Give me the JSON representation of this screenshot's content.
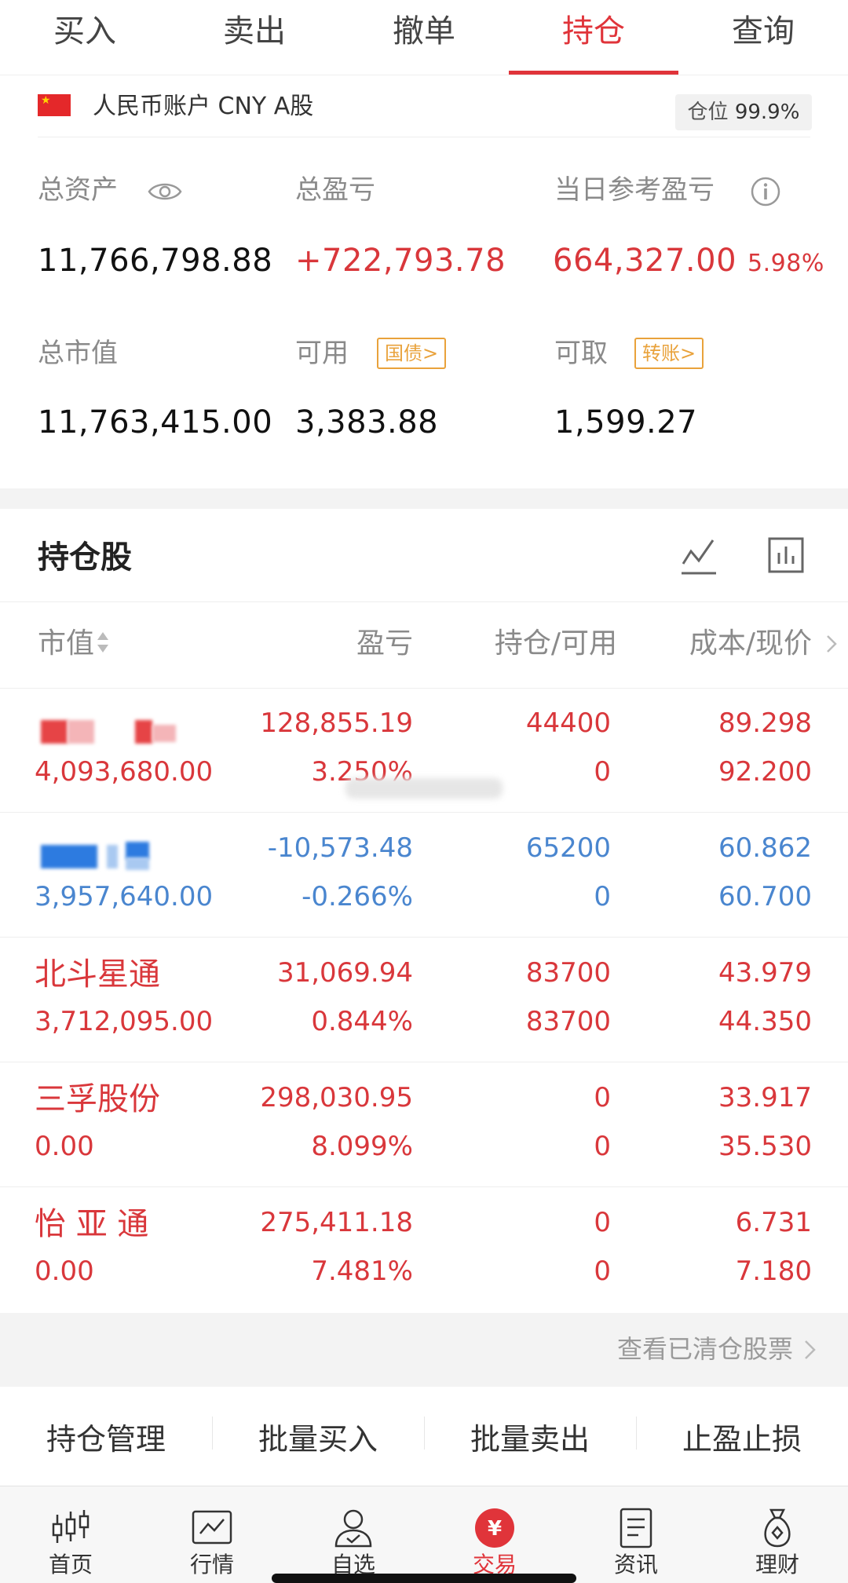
{
  "tabs": [
    {
      "label": "买入"
    },
    {
      "label": "卖出"
    },
    {
      "label": "撤单"
    },
    {
      "label": "持仓",
      "active": true
    },
    {
      "label": "查询"
    }
  ],
  "account": {
    "label": "人民币账户 CNY A股",
    "position_label": "仓位",
    "position_value": "99.9%"
  },
  "summary": {
    "total_assets": {
      "label": "总资产",
      "value": "11,766,798.88"
    },
    "total_pnl": {
      "label": "总盈亏",
      "value": "+722,793.78"
    },
    "daily_pnl": {
      "label": "当日参考盈亏",
      "value": "664,327.00",
      "pct": "5.98%"
    },
    "market_value": {
      "label": "总市值",
      "value": "11,763,415.00"
    },
    "available": {
      "label": "可用",
      "value": "3,383.88",
      "tag": "国债>"
    },
    "withdrawable": {
      "label": "可取",
      "value": "1,599.27",
      "tag": "转账>"
    }
  },
  "holdings": {
    "title": "持仓股",
    "columns": [
      "市值",
      "盈亏",
      "持仓/可用",
      "成本/现价"
    ],
    "rows": [
      {
        "name": "",
        "market_value": "4,093,680.00",
        "pnl": "128,855.19",
        "pnl_pct": "3.250%",
        "position": "44400",
        "available": "0",
        "cost": "89.298",
        "price": "92.200",
        "color": "red"
      },
      {
        "name": "",
        "market_value": "3,957,640.00",
        "pnl": "-10,573.48",
        "pnl_pct": "-0.266%",
        "position": "65200",
        "available": "0",
        "cost": "60.862",
        "price": "60.700",
        "color": "blue"
      },
      {
        "name": "北斗星通",
        "market_value": "3,712,095.00",
        "pnl": "31,069.94",
        "pnl_pct": "0.844%",
        "position": "83700",
        "available": "83700",
        "cost": "43.979",
        "price": "44.350",
        "color": "red"
      },
      {
        "name": "三孚股份",
        "market_value": "0.00",
        "pnl": "298,030.95",
        "pnl_pct": "8.099%",
        "position": "0",
        "available": "0",
        "cost": "33.917",
        "price": "35.530",
        "color": "red"
      },
      {
        "name": "怡 亚 通",
        "market_value": "0.00",
        "pnl": "275,411.18",
        "pnl_pct": "7.481%",
        "position": "0",
        "available": "0",
        "cost": "6.731",
        "price": "7.180",
        "color": "red"
      }
    ],
    "cleared_link": "查看已清仓股票"
  },
  "actions": [
    "持仓管理",
    "批量买入",
    "批量卖出",
    "止盈止损"
  ],
  "bottom_nav": [
    {
      "label": "首页",
      "icon": "candlestick-icon"
    },
    {
      "label": "行情",
      "icon": "chart-icon"
    },
    {
      "label": "自选",
      "icon": "user-check-icon"
    },
    {
      "label": "交易",
      "icon": "yuan-icon",
      "active": true
    },
    {
      "label": "资讯",
      "icon": "document-icon"
    },
    {
      "label": "理财",
      "icon": "money-bag-icon"
    }
  ],
  "colors": {
    "accent": "#e0343a",
    "up": "#d9373b",
    "down": "#4a86cf",
    "tag": "#e9a23b"
  }
}
